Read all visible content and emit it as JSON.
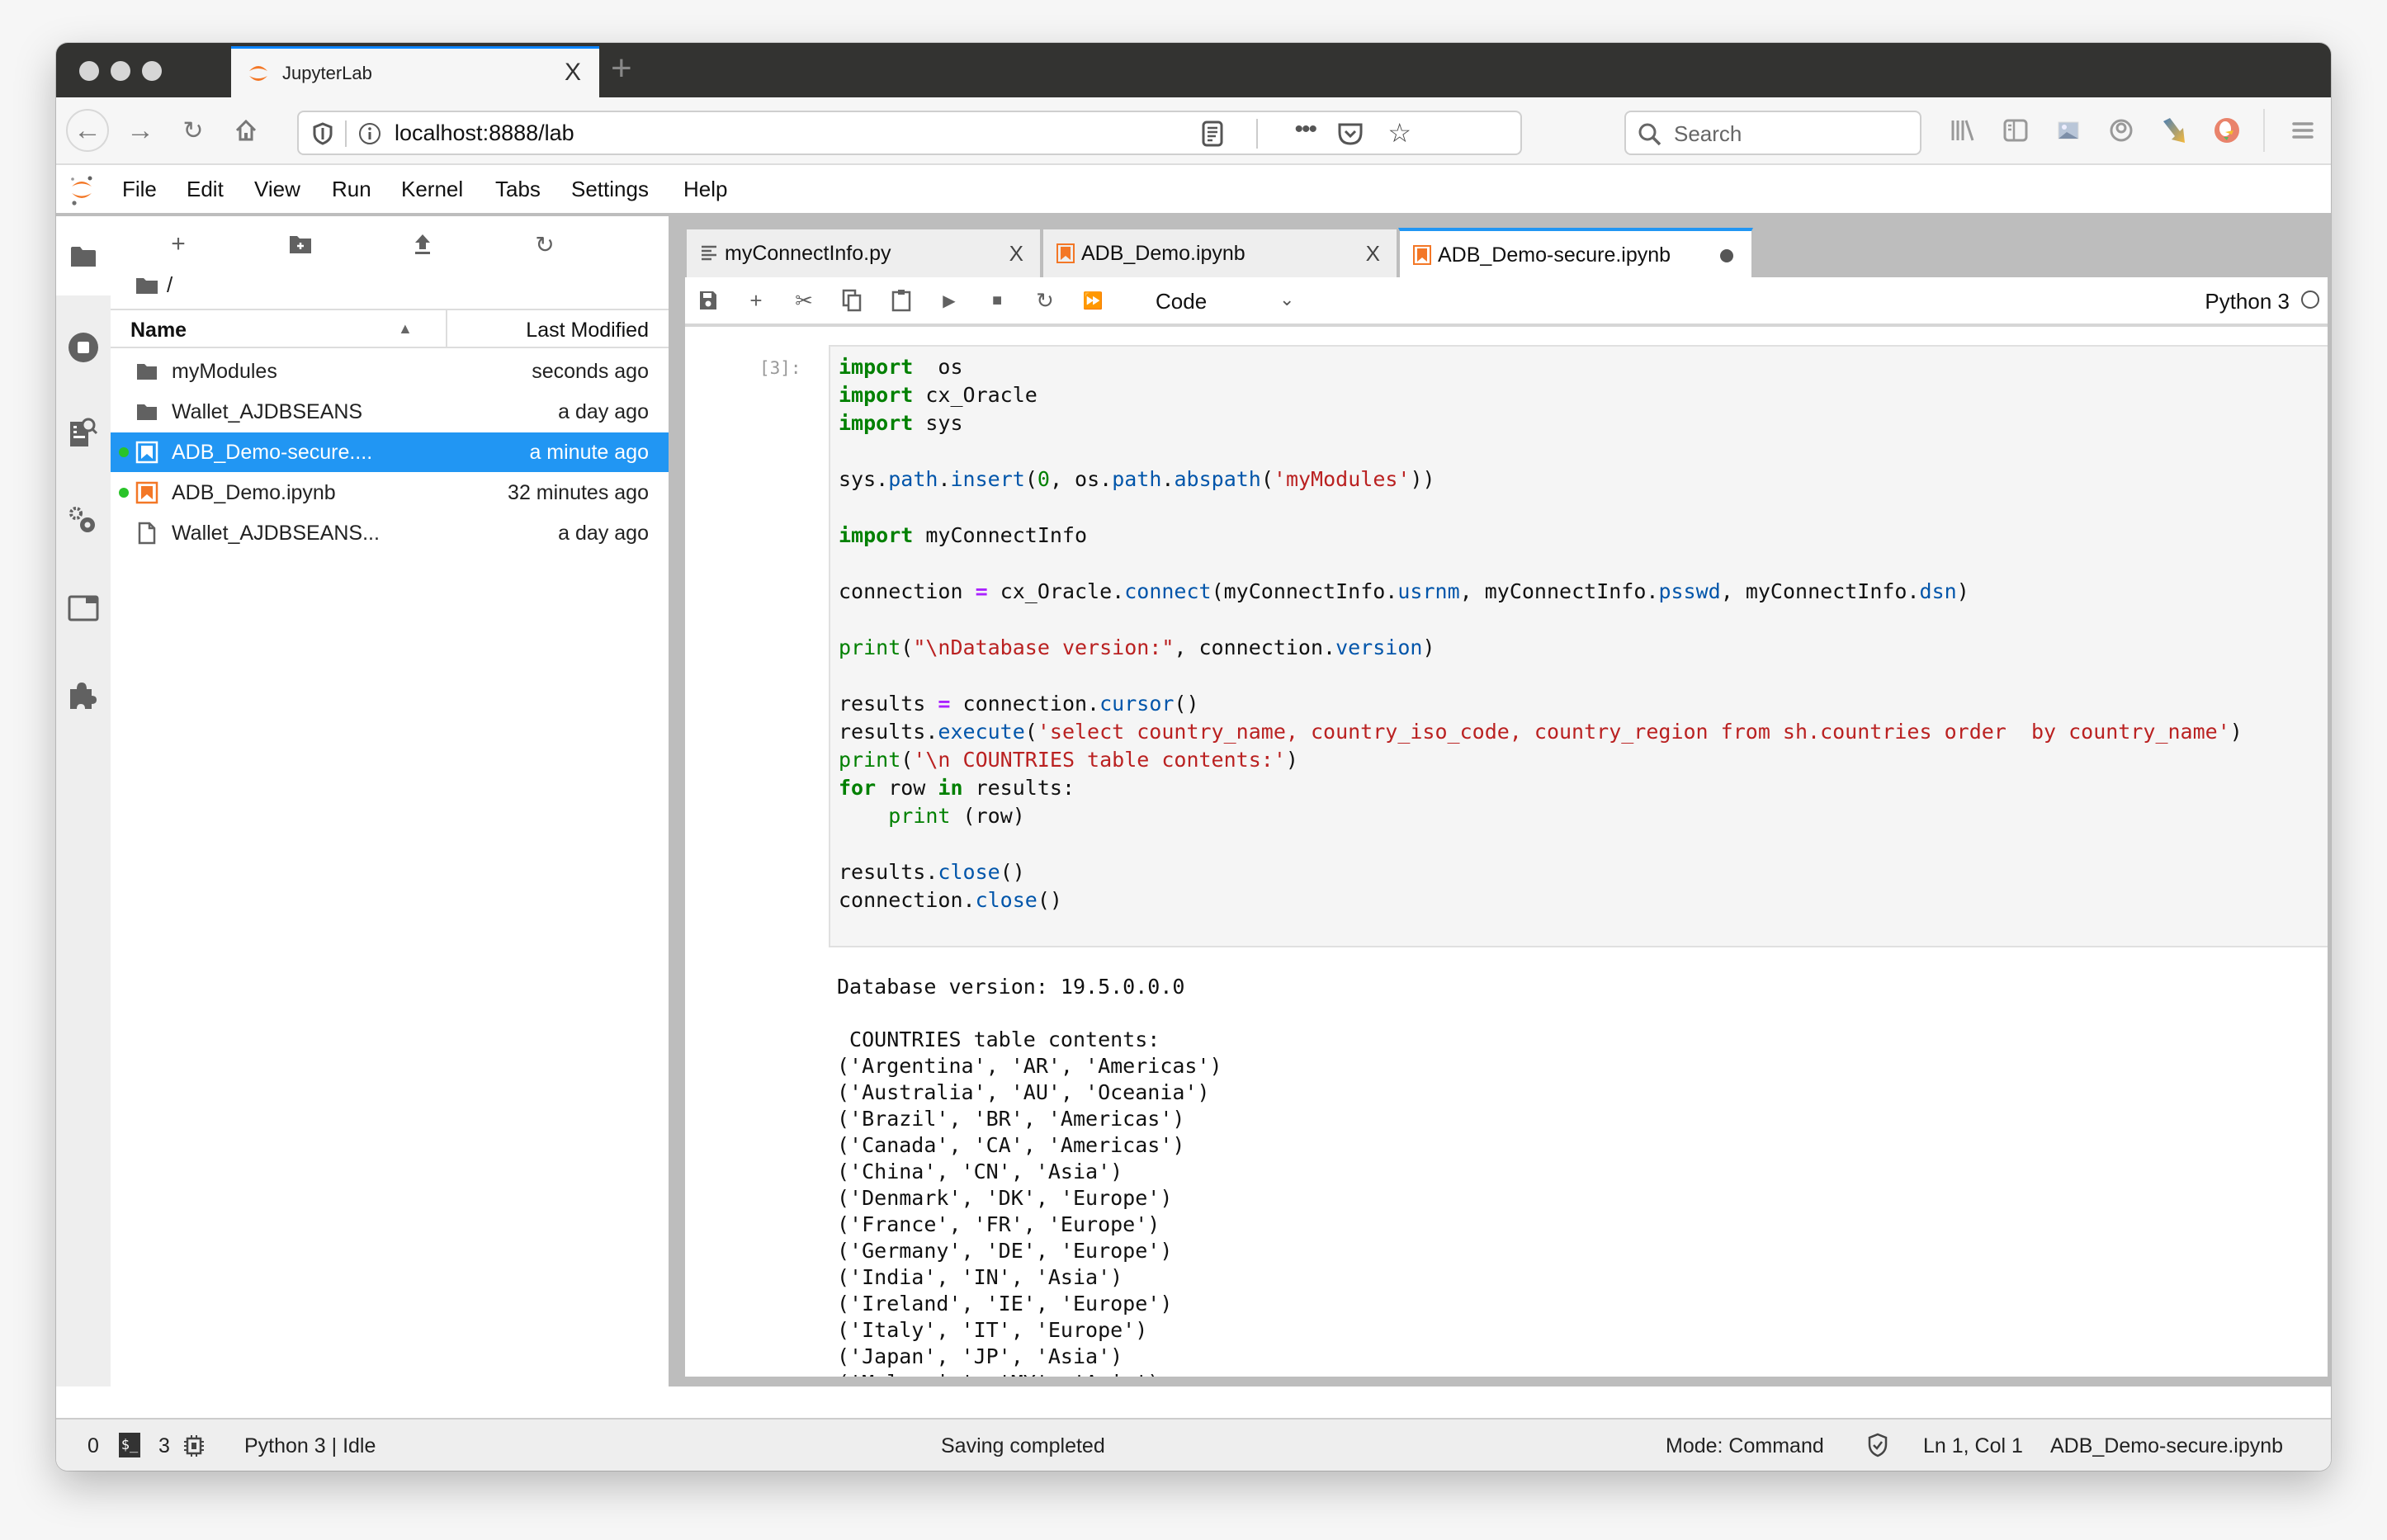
{
  "browser": {
    "tab_title": "JupyterLab",
    "tab_close": "X",
    "new_tab": "+",
    "url": "localhost:8888/lab",
    "search_placeholder": "Search",
    "icons": [
      "back-arrow-icon",
      "forward-arrow-icon",
      "reload-icon",
      "home-icon",
      "shield-icon",
      "info-icon",
      "reader-view-icon",
      "more-actions-icon",
      "pocket-icon",
      "bookmark-star-icon",
      "search-icon",
      "library-icon",
      "sidebar-icon",
      "screenshot-icon",
      "account-icon",
      "extension-arrow-icon",
      "duckduckgo-icon",
      "hamburger-menu-icon"
    ]
  },
  "menubar": {
    "items": [
      "File",
      "Edit",
      "View",
      "Run",
      "Kernel",
      "Tabs",
      "Settings",
      "Help"
    ]
  },
  "filebrowser": {
    "breadcrumb": "/",
    "columns": {
      "name": "Name",
      "modified": "Last Modified"
    },
    "files": [
      {
        "name": "myModules",
        "modified": "seconds ago",
        "type": "folder",
        "running": false,
        "selected": false
      },
      {
        "name": "Wallet_AJDBSEANS",
        "modified": "a day ago",
        "type": "folder",
        "running": false,
        "selected": false
      },
      {
        "name": "ADB_Demo-secure....",
        "modified": "a minute ago",
        "type": "notebook",
        "running": true,
        "selected": true
      },
      {
        "name": "ADB_Demo.ipynb",
        "modified": "32 minutes ago",
        "type": "notebook",
        "running": true,
        "selected": false
      },
      {
        "name": "Wallet_AJDBSEANS...",
        "modified": "a day ago",
        "type": "file",
        "running": false,
        "selected": false
      }
    ]
  },
  "tabs": [
    {
      "label": "myConnectInfo.py",
      "close": "X",
      "active": false
    },
    {
      "label": "ADB_Demo.ipynb",
      "close": "X",
      "active": false
    },
    {
      "label": "ADB_Demo-secure.ipynb",
      "close": "",
      "active": true,
      "dirty": true
    }
  ],
  "notebook": {
    "cell_type": "Code",
    "kernel": "Python 3",
    "prompt": "[3]:",
    "output": "Database version: 19.5.0.0.0\n\n COUNTRIES table contents:\n('Argentina', 'AR', 'Americas')\n('Australia', 'AU', 'Oceania')\n('Brazil', 'BR', 'Americas')\n('Canada', 'CA', 'Americas')\n('China', 'CN', 'Asia')\n('Denmark', 'DK', 'Europe')\n('France', 'FR', 'Europe')\n('Germany', 'DE', 'Europe')\n('India', 'IN', 'Asia')\n('Ireland', 'IE', 'Europe')\n('Italy', 'IT', 'Europe')\n('Japan', 'JP', 'Asia')\n('Malaysia', 'MY', 'Asia')\n('New Zealand', 'NZ', 'Oceania')"
  },
  "code_lines": [
    [
      [
        "kw",
        "import"
      ],
      [
        "",
        "  os"
      ]
    ],
    [
      [
        "kw",
        "import"
      ],
      [
        "",
        " cx_Oracle"
      ]
    ],
    [
      [
        "kw",
        "import"
      ],
      [
        "",
        " sys"
      ]
    ],
    [],
    [
      [
        "",
        "sys."
      ],
      [
        "attr",
        "path"
      ],
      [
        "",
        "."
      ],
      [
        "attr",
        "insert"
      ],
      [
        "",
        "("
      ],
      [
        "num",
        "0"
      ],
      [
        "",
        ", os."
      ],
      [
        "attr",
        "path"
      ],
      [
        "",
        "."
      ],
      [
        "attr",
        "abspath"
      ],
      [
        "",
        "("
      ],
      [
        "str",
        "'myModules'"
      ],
      [
        "",
        "))"
      ]
    ],
    [],
    [
      [
        "kw",
        "import"
      ],
      [
        "",
        " myConnectInfo"
      ]
    ],
    [],
    [
      [
        "",
        "connection "
      ],
      [
        "op",
        "="
      ],
      [
        "",
        " cx_Oracle."
      ],
      [
        "attr",
        "connect"
      ],
      [
        "",
        "(myConnectInfo."
      ],
      [
        "attr",
        "usrnm"
      ],
      [
        "",
        ", myConnectInfo."
      ],
      [
        "attr",
        "psswd"
      ],
      [
        "",
        ", myConnectInfo."
      ],
      [
        "attr",
        "dsn"
      ],
      [
        "",
        ")"
      ]
    ],
    [],
    [
      [
        "bi",
        "print"
      ],
      [
        "",
        "("
      ],
      [
        "str",
        "\"\\nDatabase version:\""
      ],
      [
        "",
        ", connection."
      ],
      [
        "attr",
        "version"
      ],
      [
        "",
        ")"
      ]
    ],
    [],
    [
      [
        "",
        "results "
      ],
      [
        "op",
        "="
      ],
      [
        "",
        " connection."
      ],
      [
        "attr",
        "cursor"
      ],
      [
        "",
        "()"
      ]
    ],
    [
      [
        "",
        "results."
      ],
      [
        "attr",
        "execute"
      ],
      [
        "",
        "("
      ],
      [
        "str",
        "'select country_name, country_iso_code, country_region from sh.countries order  by country_name'"
      ],
      [
        "",
        ")"
      ]
    ],
    [
      [
        "bi",
        "print"
      ],
      [
        "",
        "("
      ],
      [
        "str",
        "'\\n COUNTRIES table contents:'"
      ],
      [
        "",
        ")"
      ]
    ],
    [
      [
        "kw",
        "for"
      ],
      [
        "",
        " row "
      ],
      [
        "kw",
        "in"
      ],
      [
        "",
        " results:"
      ]
    ],
    [
      [
        "",
        "    "
      ],
      [
        "bi",
        "print"
      ],
      [
        "",
        " (row)"
      ]
    ],
    [],
    [
      [
        "",
        "results."
      ],
      [
        "attr",
        "close"
      ],
      [
        "",
        "()"
      ]
    ],
    [
      [
        "",
        "connection."
      ],
      [
        "attr",
        "close"
      ],
      [
        "",
        "()"
      ]
    ]
  ],
  "statusbar": {
    "terminals": "0",
    "kernels": "3",
    "kernel_status": "Python 3 | Idle",
    "message": "Saving completed",
    "mode": "Mode: Command",
    "cursor": "Ln 1, Col 1",
    "filename": "ADB_Demo-secure.ipynb"
  },
  "colors": {
    "accent": "#2196f3",
    "jupyter_orange": "#f37726",
    "running_dot": "#29c329"
  }
}
